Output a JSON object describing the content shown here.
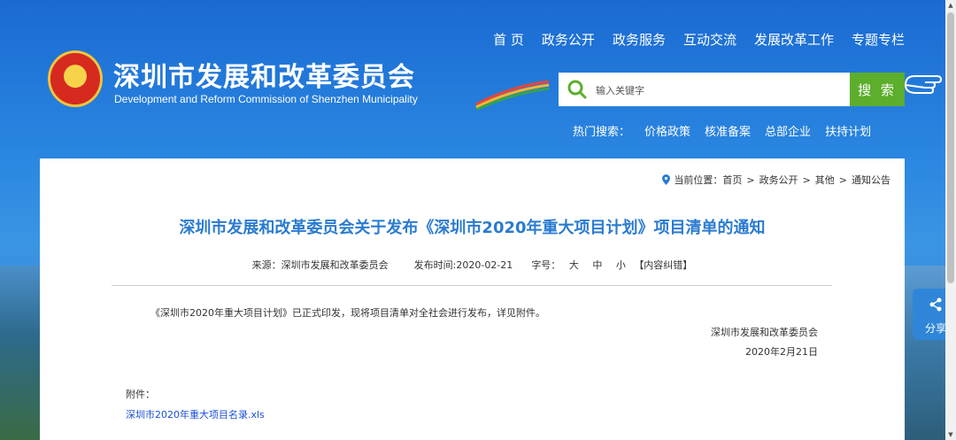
{
  "header": {
    "title": "深圳市发展和改革委员会",
    "subtitle": "Development and Reform Commission of Shenzhen Municipality",
    "nav": [
      "首 页",
      "政务公开",
      "政务服务",
      "互动交流",
      "发展改革工作",
      "专题专栏"
    ]
  },
  "search": {
    "placeholder": "输入关键字",
    "button_label": "搜 索"
  },
  "hot_search": {
    "label": "热门搜索：",
    "items": [
      "价格政策",
      "核准备案",
      "总部企业",
      "扶持计划"
    ]
  },
  "breadcrumb": {
    "prefix": "当前位置：",
    "items": [
      "首页",
      "政务公开",
      "其他",
      "通知公告"
    ],
    "separator": ">"
  },
  "article": {
    "title": "深圳市发展和改革委员会关于发布《深圳市2020年重大项目计划》项目清单的通知",
    "source": "来源：深圳市发展和改革委员会",
    "publish_time": "发布时间:2020-02-21",
    "font_size_label": "字号：",
    "font_sizes": [
      "大",
      "中",
      "小"
    ],
    "correction": "【内容纠错】",
    "body": "《深圳市2020年重大项目计划》已正式印发，现将项目清单对全社会进行发布，详见附件。",
    "sign_org": "深圳市发展和改革委员会",
    "sign_date": "2020年2月21日",
    "attachment_label": "附件：",
    "attachment_link": "深圳市2020年重大项目名录.xls"
  },
  "share": {
    "label": "分享"
  },
  "colors": {
    "accent": "#2a7bd0",
    "search_button": "#5cae2c",
    "link": "#1a4fd6"
  }
}
